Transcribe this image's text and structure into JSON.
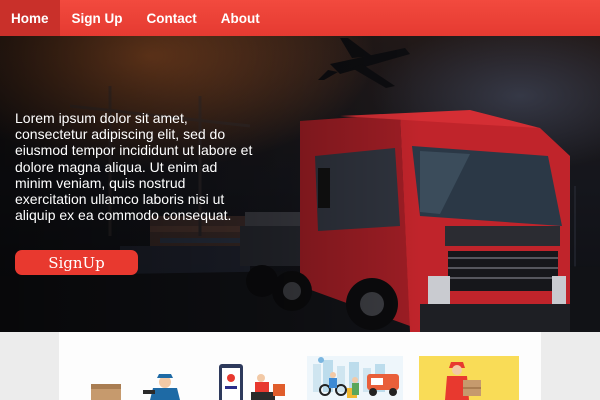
{
  "nav": {
    "items": [
      {
        "label": "Home",
        "active": true
      },
      {
        "label": "Sign Up",
        "active": false
      },
      {
        "label": "Contact",
        "active": false
      },
      {
        "label": "About",
        "active": false
      }
    ]
  },
  "hero": {
    "text": "Lorem ipsum dolor sit amet, consectetur adipiscing elit, sed do eiusmod tempor incididunt ut labore et dolore magna aliqua. Ut enim ad minim veniam, quis nostrud exercitation ullamco laboris nisi ut aliquip ex ea commodo consequat.",
    "cta_label": "SignUp",
    "image": "truck-airplane-cargo-photo"
  },
  "services": [
    {
      "image": "box-delivery-illustration"
    },
    {
      "image": "mobile-order-delivery-illustration"
    },
    {
      "image": "city-courier-illustration"
    },
    {
      "image": "courier-holding-box-illustration"
    }
  ],
  "colors": {
    "nav_bg": "#f24a3e",
    "nav_active": "#c9302a",
    "cta_bg": "#e8392f",
    "page_bg": "#ececec"
  }
}
